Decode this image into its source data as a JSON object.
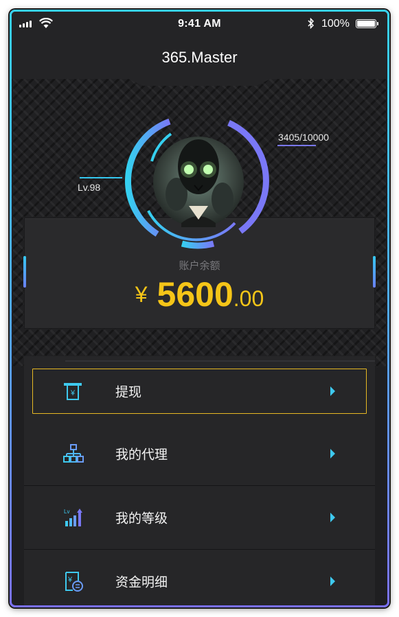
{
  "status_bar": {
    "time": "9:41 AM",
    "battery": "100%"
  },
  "nav": {
    "title": "365.Master"
  },
  "profile": {
    "level": "Lv.98",
    "experience": "3405/10000",
    "experience_progress": 0.3405,
    "balance_label": "账户余额",
    "currency_symbol": "¥",
    "balance_integer": "5600",
    "balance_decimal": ".00"
  },
  "menu": {
    "items": [
      {
        "label": "提现",
        "icon": "withdraw-icon"
      },
      {
        "label": "我的代理",
        "icon": "org-chart-icon"
      },
      {
        "label": "我的等级",
        "icon": "level-chart-icon"
      },
      {
        "label": "资金明细",
        "icon": "fund-detail-icon"
      }
    ]
  },
  "colors": {
    "accent_gold": "#f5c518",
    "ring_gradient_start": "#35d0f0",
    "ring_gradient_end": "#7a78f7",
    "chevron": "#3ec9ef"
  }
}
